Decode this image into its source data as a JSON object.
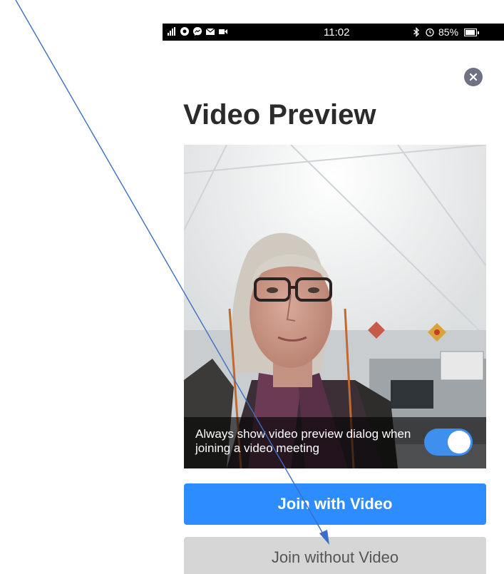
{
  "status_bar": {
    "time": "11:02",
    "battery": "85%",
    "left_icons": [
      "signal-icon",
      "chrome-icon",
      "messenger-icon",
      "mail-icon",
      "video-icon"
    ],
    "right_icons": [
      "bluetooth-icon",
      "alarm-icon",
      "battery-icon"
    ]
  },
  "dialog": {
    "title": "Video Preview",
    "preview_option_text": "Always show video preview dialog when joining a video meeting",
    "preview_option_enabled": true,
    "join_with_video_label": "Join with Video",
    "join_without_video_label": "Join without Video"
  },
  "colors": {
    "primary_button": "#2d8cff",
    "secondary_button": "#d6d6d6",
    "toggle_on": "#3f90ee",
    "close_button": "#6f7283",
    "annotation_arrow": "#3a6fc4"
  }
}
